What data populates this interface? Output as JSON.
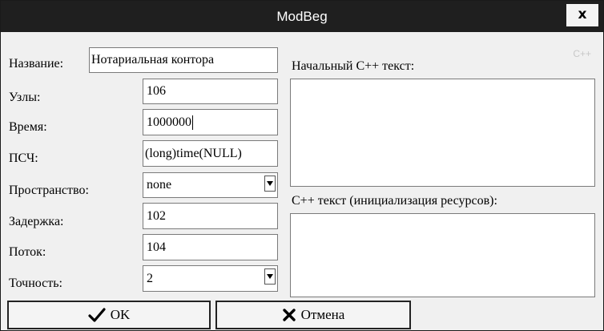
{
  "window": {
    "title": "ModBeg",
    "close_label": "x"
  },
  "form": {
    "name_label": "Название:",
    "name_value": "Нотариальная контора",
    "nodes_label": "Узлы:",
    "nodes_value": "106",
    "time_label": "Время:",
    "time_value": "1000000",
    "rng_label": "ПСЧ:",
    "rng_value": "(long)time(NULL)",
    "space_label": "Пространство:",
    "space_value": "none",
    "delay_label": "Задержка:",
    "delay_value": "102",
    "flow_label": "Поток:",
    "flow_value": "104",
    "precision_label": "Точность:",
    "precision_value": "2"
  },
  "cpp": {
    "hint": "C++",
    "initial_label": "Начальный C++ текст:",
    "initial_text": "",
    "resources_label": "C++ текст (инициализация ресурсов):",
    "resources_text": ""
  },
  "buttons": {
    "ok_label": "OK",
    "cancel_label": "Отмена"
  },
  "icons": {
    "ok": "checkmark-icon",
    "cancel": "x-cross-icon",
    "dropdown": "chevron-down-icon"
  }
}
